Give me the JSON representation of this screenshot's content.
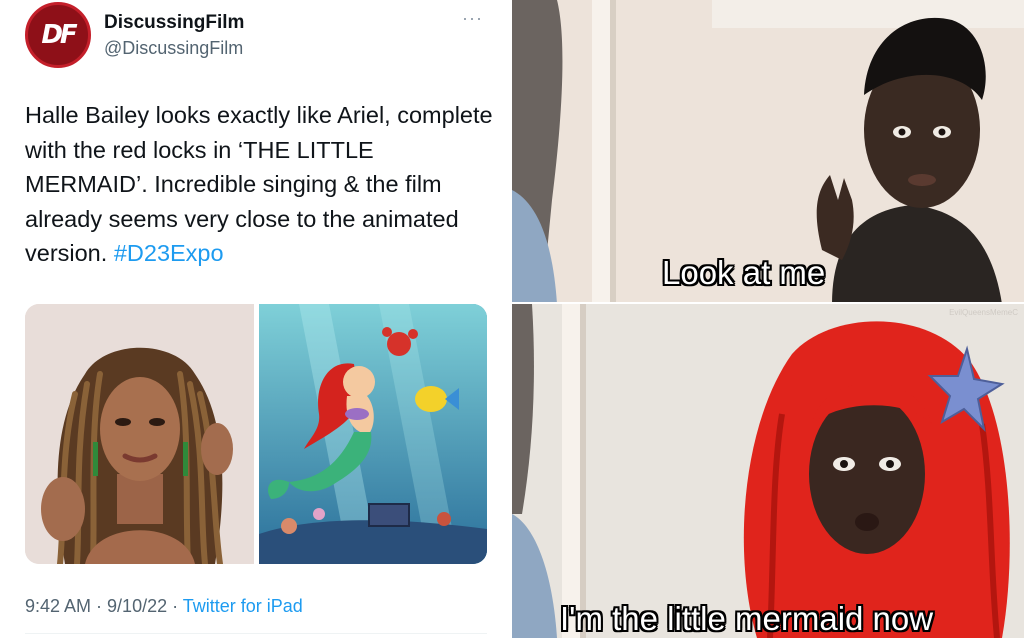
{
  "tweet": {
    "avatar_text": "DF",
    "display_name": "DiscussingFilm",
    "handle": "@DiscussingFilm",
    "more_icon": "···",
    "text": "Halle Bailey looks exactly like Ariel, complete with the red locks in ‘THE LITTLE MERMAID’. Incredible singing & the film already seems very close to the animated version. ",
    "hashtag": "#D23Expo",
    "meta": {
      "time": "9:42 AM",
      "date": "9/10/22",
      "separator": " · ",
      "source": "Twitter for iPad"
    }
  },
  "meme": {
    "caption_top": "Look at me",
    "caption_bottom": "I'm the little mermaid now",
    "watermark": "EvilQueensMemeC"
  },
  "colors": {
    "link": "#1d9bf0",
    "text": "#0f1419",
    "secondary": "#536471",
    "avatar": "#8e1018"
  }
}
